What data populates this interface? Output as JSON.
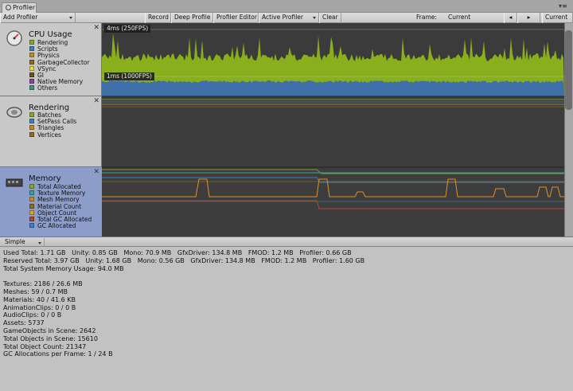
{
  "window": {
    "tab_title": "Profiler"
  },
  "toolbar": {
    "add_profiler": "Add Profiler",
    "record": "Record",
    "deep_profile": "Deep Profile",
    "profiler_editor": "Profiler Editor",
    "active_profiler": "Active Profiler",
    "clear": "Clear",
    "frame_label": "Frame:",
    "frame_value": "Current",
    "prev_icon": "step-back-icon",
    "next_icon": "step-forward-icon",
    "current_button": "Current"
  },
  "areas": {
    "cpu": {
      "title": "CPU Usage",
      "legend": [
        {
          "label": "Rendering",
          "color": "#8aa52d"
        },
        {
          "label": "Scripts",
          "color": "#3f7fbf"
        },
        {
          "label": "Physics",
          "color": "#c58a25"
        },
        {
          "label": "GarbageCollector",
          "color": "#8a6d2a"
        },
        {
          "label": "VSync",
          "color": "#e9d84a"
        },
        {
          "label": "GI",
          "color": "#6b5323"
        },
        {
          "label": "Native Memory",
          "color": "#7f4b9b"
        },
        {
          "label": "Others",
          "color": "#4a8d86"
        }
      ],
      "marker_top": "4ms (250FPS)",
      "marker_bottom": "1ms (1000FPS)"
    },
    "rendering": {
      "title": "Rendering",
      "legend": [
        {
          "label": "Batches",
          "color": "#8aa52d"
        },
        {
          "label": "SetPass Calls",
          "color": "#3f7fbf"
        },
        {
          "label": "Triangles",
          "color": "#c58a25"
        },
        {
          "label": "Vertices",
          "color": "#8a6d2a"
        }
      ]
    },
    "memory": {
      "title": "Memory",
      "legend": [
        {
          "label": "Total Allocated",
          "color": "#8aa52d"
        },
        {
          "label": "Texture Memory",
          "color": "#3f9f9f"
        },
        {
          "label": "Mesh Memory",
          "color": "#c58a25"
        },
        {
          "label": "Material Count",
          "color": "#8a6d2a"
        },
        {
          "label": "Object Count",
          "color": "#e0a030"
        },
        {
          "label": "Total GC Allocated",
          "color": "#b04a2a"
        },
        {
          "label": "GC Allocated",
          "color": "#3f7fbf"
        }
      ]
    }
  },
  "details": {
    "view_mode": "Simple",
    "lines": [
      "Used Total: 1.71 GB   Unity: 0.85 GB   Mono: 70.9 MB   GfxDriver: 134.8 MB   FMOD: 1.2 MB   Profiler: 0.66 GB",
      "Reserved Total: 3.97 GB   Unity: 1.68 GB   Mono: 0.56 GB   GfxDriver: 134.8 MB   FMOD: 1.2 MB   Profiler: 1.60 GB",
      "Total System Memory Usage: 94.0 MB",
      "",
      "Textures: 2186 / 26.6 MB",
      "Meshes: 59 / 0.7 MB",
      "Materials: 40 / 41.6 KB",
      "AnimationClips: 0 / 0 B",
      "AudioClips: 0 / 0 B",
      "Assets: 5737",
      "GameObjects in Scene: 2642",
      "Total Objects in Scene: 15610",
      "Total Object Count: 21347",
      "GC Allocations per Frame: 1 / 24 B"
    ]
  }
}
